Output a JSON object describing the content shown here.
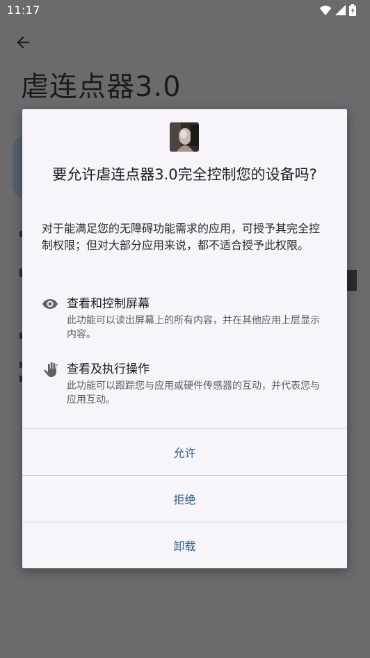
{
  "status_bar": {
    "time": "11:17",
    "icons": [
      "wifi-icon",
      "signal-icon",
      "battery-icon"
    ]
  },
  "app": {
    "title": "虐连点器3.0",
    "back_icon": "arrow-back-icon"
  },
  "dialog": {
    "app_icon": "app-icon-photo",
    "title": "要允许虐连点器3.0完全控制您的设备吗?",
    "description": "对于能满足您的无障碍功能需求的应用，可授予其完全控制权限；但对大部分应用来说，都不适合授予此权限。",
    "permissions": [
      {
        "icon": "eye-icon",
        "title": "查看和控制屏幕",
        "description": "此功能可以读出屏幕上的所有内容，并在其他应用上层显示内容。"
      },
      {
        "icon": "hand-icon",
        "title": "查看及执行操作",
        "description": "此功能可以跟踪您与应用或硬件传感器的互动，并代表您与应用互动。"
      }
    ],
    "buttons": {
      "allow": "允许",
      "deny": "拒绝",
      "uninstall": "卸载"
    }
  },
  "colors": {
    "scrim": "#6b6b6d",
    "dialog_bg": "#f7f5fa",
    "button_text": "#2f5f86",
    "divider": "#d2d0d6"
  }
}
